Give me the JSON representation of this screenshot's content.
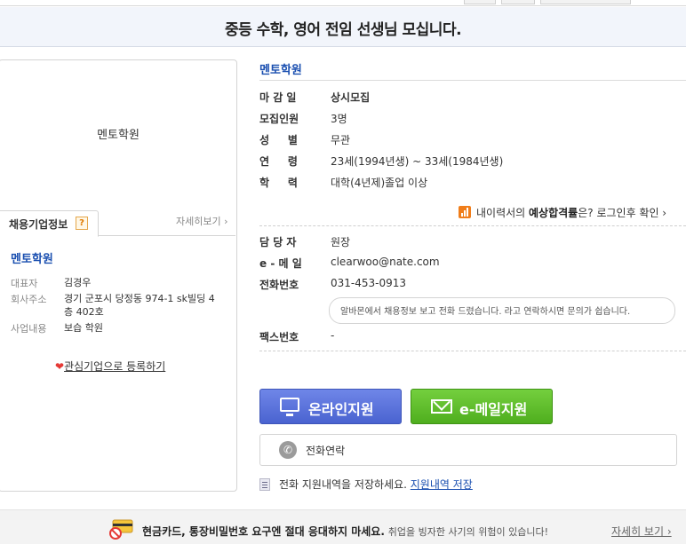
{
  "header": {
    "title": "중등 수학, 영어 전임 선생님 모십니다."
  },
  "company_panel": {
    "logo_text": "멘토학원",
    "tab_label": "채용기업정보",
    "help_badge": "?",
    "more_link": "자세히보기 ›",
    "company_name": "멘토학원",
    "info": [
      {
        "key": "대표자",
        "value": "김경우"
      },
      {
        "key": "회사주소",
        "value": "경기 군포시 당정동 974-1 sk빌딩 4층 402호"
      },
      {
        "key": "사업내용",
        "value": "보습 학원"
      }
    ],
    "favorite_label": "관심기업으로 등록하기"
  },
  "job": {
    "title": "멘토학원",
    "details": [
      {
        "key": "마 감 일",
        "value": "상시모집"
      },
      {
        "key": "모집인원",
        "value": "3명"
      },
      {
        "key": "성     별",
        "value": "무관"
      },
      {
        "key": "연     령",
        "value": "23세(1994년생) ~ 33세(1984년생)"
      },
      {
        "key": "학     력",
        "value": "대학(4년제)졸업 이상"
      }
    ],
    "pass_rate": {
      "prefix": "내이력서의 ",
      "bold": "예상합격률",
      "suffix": "은? 로그인후 확인 ›"
    },
    "contact": [
      {
        "key": "담 당 자",
        "value": "원장"
      },
      {
        "key": "e - 메 일",
        "value": "clearwoo@nate.com"
      },
      {
        "key": "전화번호",
        "value": "031-453-0913"
      }
    ],
    "contact_note": "알바몬에서 채용정보 보고 전화 드렸습니다. 라고 연락하시면 문의가 쉽습니다.",
    "fax": {
      "key": "팩스번호",
      "value": "-"
    }
  },
  "actions": {
    "online_apply": "온라인지원",
    "email_apply": "e-메일지원",
    "phone_contact": "전화연락",
    "save_prefix": "전화 지원내역을 저장하세요.",
    "save_link": "지원내역 저장"
  },
  "warning": {
    "bold": "현금카드, 통장비밀번호 요구엔 절대 응대하지 마세요.",
    "sub": "취업을 빙자한 사기의 위험이 있습니다!",
    "more": "자세히 보기 ›"
  },
  "colors": {
    "accent_blue": "#1a4fb0",
    "online_button": "#4a63d0",
    "email_button": "#4fae1e",
    "chart_icon": "#f07d1a"
  }
}
